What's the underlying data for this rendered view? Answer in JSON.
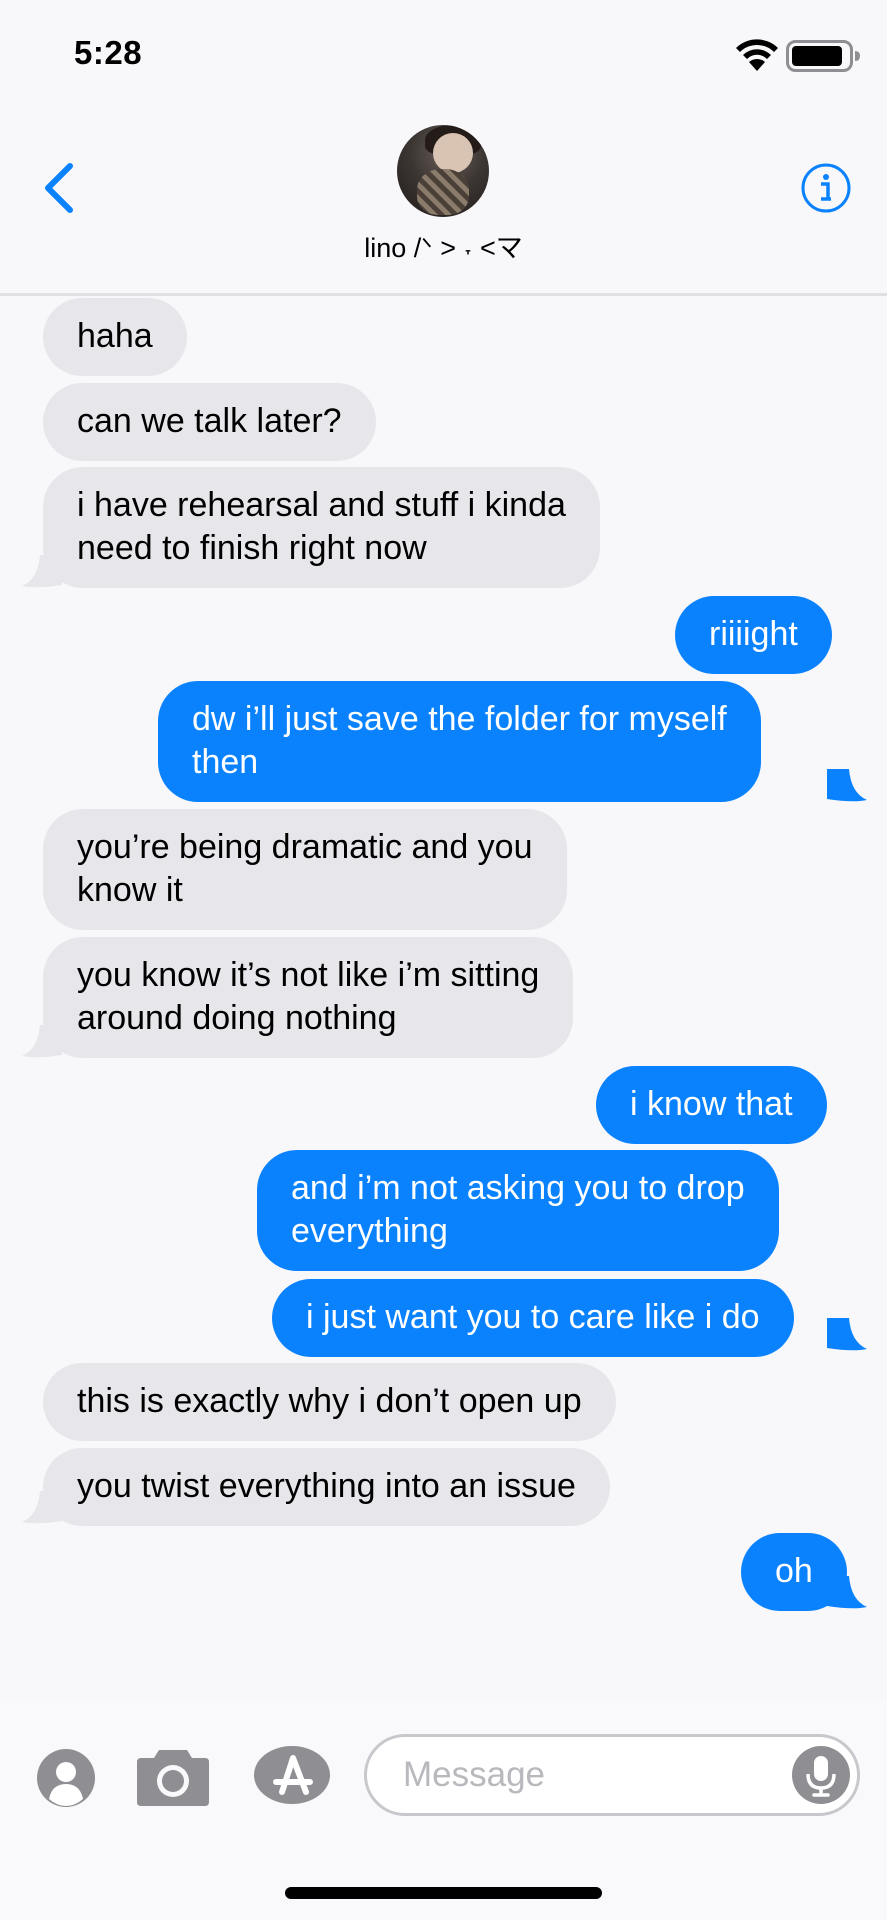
{
  "status_bar": {
    "time": "5:28"
  },
  "header": {
    "contact_name": "lino  /ᐠ > ˕ <マ"
  },
  "messages": [
    {
      "sender": "them",
      "lines": [
        "haha"
      ]
    },
    {
      "sender": "them",
      "lines": [
        "can we talk later?"
      ]
    },
    {
      "sender": "them",
      "lines": [
        "i have rehearsal and stuff i kinda",
        "need to finish right now"
      ]
    },
    {
      "sender": "me",
      "lines": [
        "riiiight"
      ]
    },
    {
      "sender": "me",
      "lines": [
        "dw i’ll just save the folder for myself",
        "then"
      ]
    },
    {
      "sender": "them",
      "lines": [
        "you’re being dramatic and you",
        "know it"
      ]
    },
    {
      "sender": "them",
      "lines": [
        "you know it’s not like i’m sitting",
        "around doing nothing"
      ]
    },
    {
      "sender": "me",
      "lines": [
        "i know that"
      ]
    },
    {
      "sender": "me",
      "lines": [
        "and i’m not asking you to drop",
        "everything"
      ]
    },
    {
      "sender": "me",
      "lines": [
        "i just want you to care like i do"
      ]
    },
    {
      "sender": "them",
      "lines": [
        "this is exactly why i don’t open up"
      ]
    },
    {
      "sender": "them",
      "lines": [
        "you twist everything into an issue"
      ]
    },
    {
      "sender": "me",
      "lines": [
        "oh"
      ]
    }
  ],
  "input": {
    "placeholder": "Message"
  },
  "colors": {
    "accent": "#0a82fe",
    "incoming_bubble": "#e7e6eb",
    "icon_gray": "#8e8e93"
  }
}
